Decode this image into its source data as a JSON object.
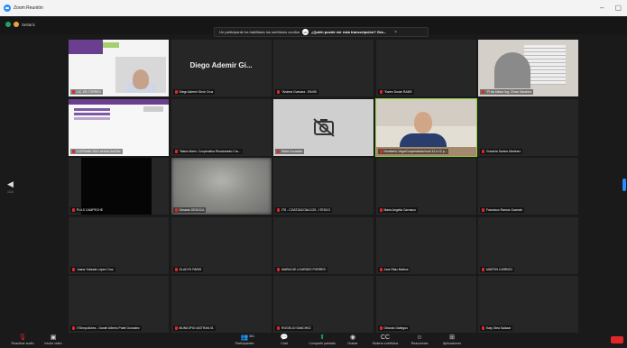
{
  "window": {
    "title": "Zoom Reunión"
  },
  "topbar": {
    "security_label": "Seitaric"
  },
  "banner": {
    "message": "Un participante ha habilitado los subtítulos ocultos",
    "question": "¿Quién puede ver esta transcripción? Gra..."
  },
  "tiles": [
    {
      "name": "LIC. EB TORRES",
      "video": "slide"
    },
    {
      "name": "Diego Ademir Girón Cruz",
      "video": "none",
      "big": "Diego Ademir Gi..."
    },
    {
      "name": "\"Andrea Guevara - RAIIIS",
      "video": "none"
    },
    {
      "name": "\"Karen Durán RAIIIS",
      "video": "none"
    },
    {
      "name": "\"FI de Altoun Ing. Cíhan Sánchez",
      "video": "office"
    },
    {
      "name": "COFRANE 2021 AHUACAATAN",
      "video": "slide2"
    },
    {
      "name": "\"Maria Marin- Cooperativa Resaturanto Cra...",
      "video": "none"
    },
    {
      "name": "Silvia Gonzalez",
      "video": "nocam"
    },
    {
      "name": "Humberto Vega/Cooperativas/mod 12 a 12 p...",
      "video": "speaker",
      "active": true
    },
    {
      "name": "Graciela Santos Martinez",
      "video": "none"
    },
    {
      "name": "PULS CAMPECHE",
      "video": "black"
    },
    {
      "name": "Gerardo DEDOCA",
      "video": "blur"
    },
    {
      "name": "ITS - COATZACOALCOS - ITESCO",
      "video": "none"
    },
    {
      "name": "Maria Angelia Carrasco",
      "video": "none"
    },
    {
      "name": "Francisco Ramos Guzmán",
      "video": "none"
    },
    {
      "name": "Juana Yolanda López Cruz",
      "video": "none"
    },
    {
      "name": "GLADYS PARIS",
      "video": "none"
    },
    {
      "name": "MARIA DE LOURDES PORRES",
      "video": "none"
    },
    {
      "name": "Jose Eliaz Balboa",
      "video": "none"
    },
    {
      "name": "MARTIN CARRIZO",
      "video": "none"
    },
    {
      "name": "ITSenpoliches - Daniel Alberto Patet Gonzalez",
      "video": "none"
    },
    {
      "name": "MUNICIPIO IASTRAN 01",
      "video": "none"
    },
    {
      "name": "ROGELIO SANCHEZ",
      "video": "none"
    },
    {
      "name": "Orlando Gallegos",
      "video": "none"
    },
    {
      "name": "Katy Olea Salazar",
      "video": "none"
    }
  ],
  "pager": {
    "left_label": "1/10"
  },
  "toolbar": {
    "items": [
      {
        "label": "Reactivar audio",
        "icon": "microphone-icon"
      },
      {
        "label": "Iniciar video",
        "icon": "camera-icon"
      },
      {
        "label": "Participantes",
        "icon": "participants-icon",
        "count": "361"
      },
      {
        "label": "Chat",
        "icon": "chat-icon"
      },
      {
        "label": "Compartir pantalla",
        "icon": "share-screen-icon"
      },
      {
        "label": "Grabar",
        "icon": "record-icon"
      },
      {
        "label": "Mostrar subtítulos",
        "icon": "captions-icon"
      },
      {
        "label": "Reacciones",
        "icon": "reactions-icon"
      },
      {
        "label": "Aplicaciones",
        "icon": "apps-icon"
      }
    ]
  },
  "colors": {
    "accent": "#2d8cff",
    "active_speaker": "#8bd43f",
    "muted": "#e02828",
    "share": "#1fa463"
  }
}
